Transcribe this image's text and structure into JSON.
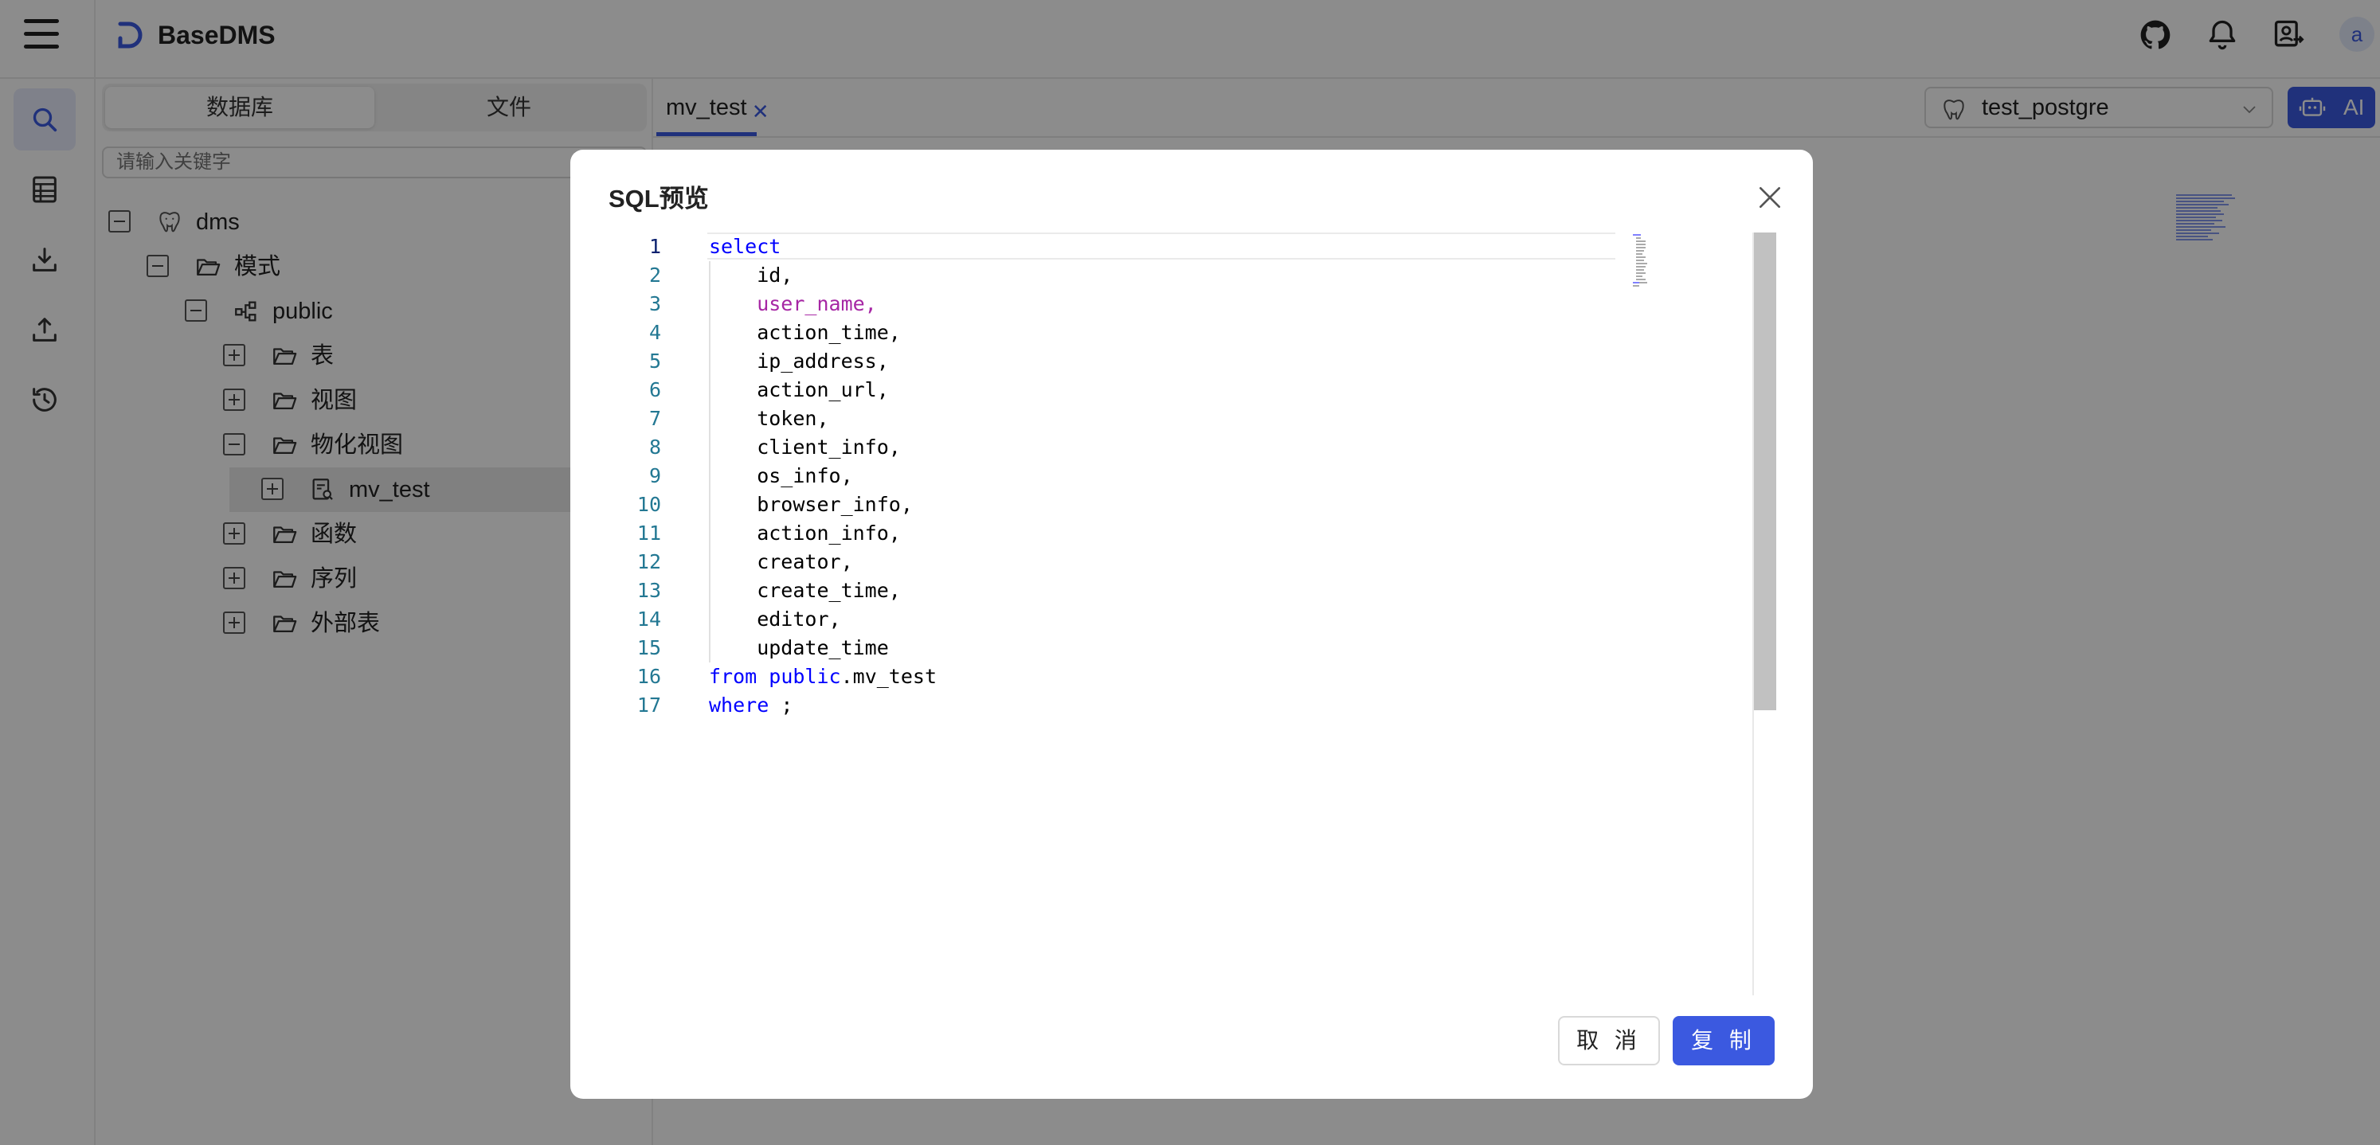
{
  "app": {
    "title": "BaseDMS"
  },
  "left_panel": {
    "tabs": [
      "数据库",
      "文件"
    ],
    "search_placeholder": "请输入关键字",
    "tree": {
      "db": "dms",
      "schema_group": "模式",
      "schema": "public",
      "folders": [
        "表",
        "视图",
        "物化视图",
        "函数",
        "序列",
        "外部表"
      ],
      "selected_item": "mv_test"
    }
  },
  "editor": {
    "tab_label": "mv_test",
    "datasource": "test_postgre",
    "ai_label": "AI"
  },
  "modal": {
    "title": "SQL预览",
    "cancel_label": "取 消",
    "copy_label": "复 制",
    "code_lines": [
      "select",
      "    id,",
      "    user_name,",
      "    action_time,",
      "    ip_address,",
      "    action_url,",
      "    token,",
      "    client_info,",
      "    os_info,",
      "    browser_info,",
      "    action_info,",
      "    creator,",
      "    create_time,",
      "    editor,",
      "    update_time",
      "from public.mv_test",
      "where ;"
    ],
    "line_numbers": [
      "1",
      "2",
      "3",
      "4",
      "5",
      "6",
      "7",
      "8",
      "9",
      "10",
      "11",
      "12",
      "13",
      "14",
      "15",
      "16",
      "17"
    ]
  },
  "icons": {
    "menu": "hamburger-icon",
    "logo": "basedms-logo-icon",
    "github": "github-icon",
    "bell": "bell-icon",
    "user_switch": "user-switch-icon",
    "avatar_letter": "a"
  },
  "colors": {
    "accent": "#3b59e0",
    "sql_keyword": "#0000ff",
    "sql_field": "#a626a4",
    "line_number": "#237893"
  }
}
